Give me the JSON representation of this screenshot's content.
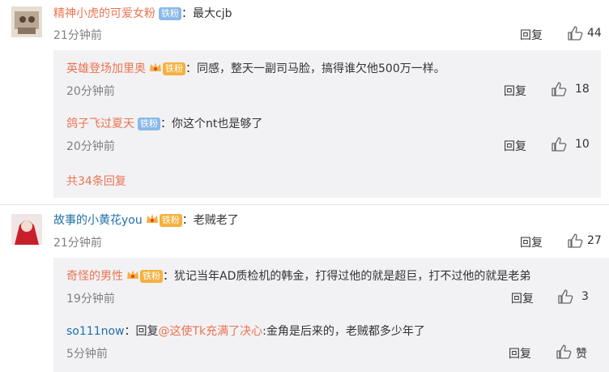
{
  "comments": [
    {
      "user": "精神小虎的可爱女粉",
      "badge": "铁粉",
      "text": "：最大cjb",
      "time": "21分钟前",
      "reply_label": "回复",
      "likes": "44",
      "replies": [
        {
          "user": "英雄登场加里奥",
          "badge": "铁粉",
          "text": "：同感，整天一副司马脸，搞得谁欠他500万一样。",
          "time": "20分钟前",
          "reply_label": "回复",
          "likes": "18"
        },
        {
          "user": "鸽子飞过夏天",
          "badge": "铁粉",
          "text": "：你这个nt也是够了",
          "time": "20分钟前",
          "reply_label": "回复",
          "likes": "10"
        }
      ],
      "more": "共34条回复"
    },
    {
      "user": "故事的小黄花you",
      "badge": "铁粉",
      "text": "：老贼老了",
      "time": "21分钟前",
      "reply_label": "回复",
      "likes": "27",
      "replies": [
        {
          "user": "奇怪的男性",
          "badge": "铁粉",
          "text": "：犹记当年AD质检机的韩金，打得过他的就是超巨，打不过他的就是老弟",
          "time": "19分钟前",
          "reply_label": "回复",
          "likes": "3"
        },
        {
          "user": "so111now",
          "prefix": "：回复",
          "mention": "@这使Tk充满了决心",
          "text": ":金角是后来的，老贼都多少年了",
          "time": "5分钟前",
          "reply_label": "回复",
          "likes": "赞"
        }
      ]
    }
  ],
  "colors": {
    "accent": "#eb7350",
    "reply_bg": "#f2f2f5",
    "badge_blue": "#8ab9e8",
    "badge_gold": "#f4b13f"
  },
  "icons": {
    "like": "thumbs-up-icon",
    "vip": "crown-icon"
  }
}
